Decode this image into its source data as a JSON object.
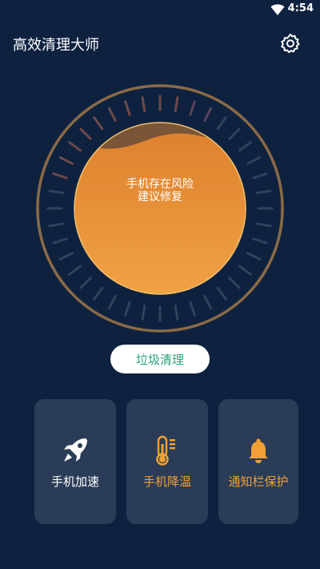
{
  "status_bar": {
    "time": "4:54"
  },
  "header": {
    "title": "高效清理大师",
    "settings_icon": "gear-icon"
  },
  "gauge": {
    "line1": "手机存在风险",
    "line2": "建议修复",
    "accent": "#e68a2e"
  },
  "actions": {
    "clean_label": "垃圾清理"
  },
  "cards": [
    {
      "label": "手机加速",
      "icon": "rocket-icon"
    },
    {
      "label": "手机降温",
      "icon": "thermometer-icon"
    },
    {
      "label": "通知栏保护",
      "icon": "bell-icon"
    }
  ],
  "colors": {
    "background": "#0e2240",
    "card": "#2a3c57",
    "orange": "#f0a035",
    "green": "#2aa57a"
  }
}
